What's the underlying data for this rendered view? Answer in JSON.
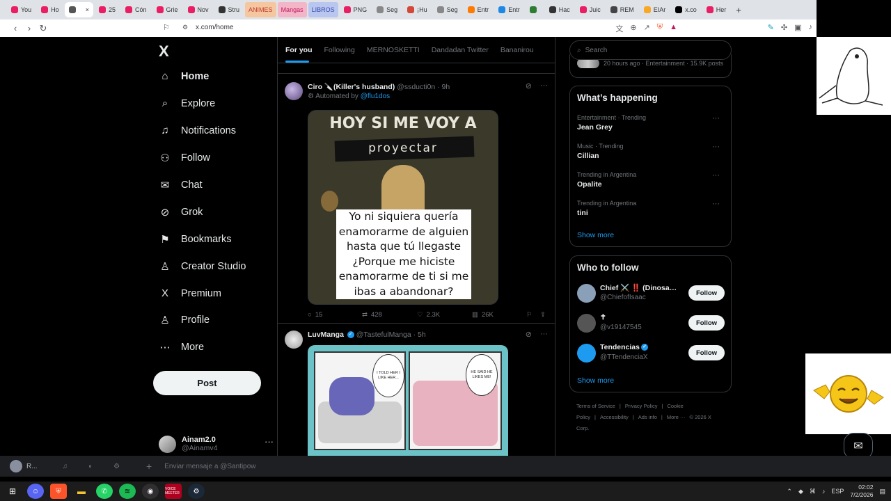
{
  "browser": {
    "tabs": [
      {
        "label": "You",
        "color": "#e91e63"
      },
      {
        "label": "Ho",
        "color": "#e91e63"
      },
      {
        "label": "",
        "color": "#555555",
        "active": true
      },
      {
        "label": "25",
        "color": "#e91e63"
      },
      {
        "label": "Cón",
        "color": "#e91e63"
      },
      {
        "label": "Grie",
        "color": "#e91e63"
      },
      {
        "label": "Nov",
        "color": "#e91e63"
      },
      {
        "label": "Stru",
        "color": "#333333"
      }
    ],
    "folders": [
      {
        "label": "ANIMES",
        "bg": "#f4c7a1",
        "fg": "#c0392b"
      },
      {
        "label": "Mangas",
        "bg": "#f3b6c8",
        "fg": "#c2185b"
      },
      {
        "label": "LIBROS",
        "bg": "#b9c7f0",
        "fg": "#3949ab"
      }
    ],
    "tabs2": [
      {
        "label": "PNG",
        "color": "#e91e63"
      },
      {
        "label": "Seg",
        "color": "#888888"
      },
      {
        "label": "¡Hu",
        "color": "#d44638"
      },
      {
        "label": "Seg",
        "color": "#888888"
      },
      {
        "label": "Entr",
        "color": "#ff7a00"
      },
      {
        "label": "Entr",
        "color": "#1e88e5"
      },
      {
        "label": "",
        "color": "#2e7d32"
      },
      {
        "label": "Hac",
        "color": "#333333"
      },
      {
        "label": "Juic",
        "color": "#e91e63"
      },
      {
        "label": "REM",
        "color": "#444444"
      },
      {
        "label": "EIAr",
        "color": "#f9a825"
      },
      {
        "label": "x.co",
        "color": "#000000"
      },
      {
        "label": "Her",
        "color": "#e91e63"
      }
    ],
    "new_tab": "+",
    "url": "x.com/home"
  },
  "sidebar": {
    "logo": "X",
    "items": [
      {
        "label": "Home",
        "icon": "home-icon",
        "glyph": "⌂"
      },
      {
        "label": "Explore",
        "icon": "search-icon",
        "glyph": "⌕"
      },
      {
        "label": "Notifications",
        "icon": "bell-icon",
        "glyph": "♫"
      },
      {
        "label": "Follow",
        "icon": "add-user-icon",
        "glyph": "⚇"
      },
      {
        "label": "Chat",
        "icon": "mail-icon",
        "glyph": "✉"
      },
      {
        "label": "Grok",
        "icon": "grok-icon",
        "glyph": "⊘"
      },
      {
        "label": "Bookmarks",
        "icon": "bookmark-icon",
        "glyph": "⚑"
      },
      {
        "label": "Creator Studio",
        "icon": "creator-icon",
        "glyph": "♙"
      },
      {
        "label": "Premium",
        "icon": "x-icon",
        "glyph": "X"
      },
      {
        "label": "Profile",
        "icon": "user-icon",
        "glyph": "♙"
      },
      {
        "label": "More",
        "icon": "more-icon",
        "glyph": "⋯"
      }
    ],
    "post_label": "Post",
    "account": {
      "name": "Ainam2.0",
      "handle": "@Ainamv4"
    }
  },
  "timeline": {
    "tabs": [
      "For you",
      "Following",
      "MERNOSKETTI",
      "Dandadan Twitter",
      "Bananirou"
    ],
    "tweets": [
      {
        "name": "Ciro 🔪(Killer's husband)",
        "handle": "@ssducti0n",
        "time": "· 9h",
        "automated_prefix": "Automated by ",
        "automated_by": "@flu1dos",
        "media_top_text": "HOY SI ME VOY A",
        "media_banner": "proyectar",
        "media_caption": "Yo ni siquiera quería enamorarme de alguien hasta que tú llegaste ¿Porque me hiciste enamorarme de ti si me ibas a abandonar?",
        "replies": "15",
        "reposts": "428",
        "likes": "2.3K",
        "views": "26K"
      },
      {
        "name": "LuvManga",
        "handle": "@TastefulManga",
        "time": "· 5h",
        "bubble_left": "I TOLD HER I LIKE HER...",
        "bubble_right": "HE SAID HE LIKES ME!"
      }
    ]
  },
  "right": {
    "search_placeholder": "Search",
    "top_meta": "20 hours ago · Entertainment · 15.9K posts",
    "happening_title": "What’s happening",
    "trends": [
      {
        "meta": "Entertainment · Trending",
        "name": "Jean Grey"
      },
      {
        "meta": "Music · Trending",
        "name": "Cillian"
      },
      {
        "meta": "Trending in Argentina",
        "name": "Opalite"
      },
      {
        "meta": "Trending in Argentina",
        "name": "tini"
      }
    ],
    "show_more": "Show more",
    "wtf_title": "Who to follow",
    "follows": [
      {
        "name": "Chief ⚔️ ‼️ (Dinosa…",
        "handle": "@ChiefofIsaac",
        "verified": true,
        "color": "#8aa0b8"
      },
      {
        "name": "✝",
        "handle": "@v19147545",
        "verified": false,
        "color": "#555555"
      },
      {
        "name": "Tendencias",
        "handle": "@TTendenciaX",
        "verified": true,
        "color": "#1d9bf0"
      }
    ],
    "follow_label": "Follow",
    "footer": [
      "Terms of Service",
      "|",
      "Privacy Policy",
      "|",
      "Cookie Policy",
      "|",
      "Accessibility",
      "|",
      "Ads info",
      "|",
      "More ···",
      "© 2026 X Corp."
    ]
  },
  "discord": {
    "user": "R...",
    "message_placeholder": "Enviar mensaje a @Santipow"
  },
  "taskbar": {
    "lang": "ESP",
    "time": "02:02",
    "date": "7/2/2026",
    "recorder": "VOICE MEETER"
  }
}
